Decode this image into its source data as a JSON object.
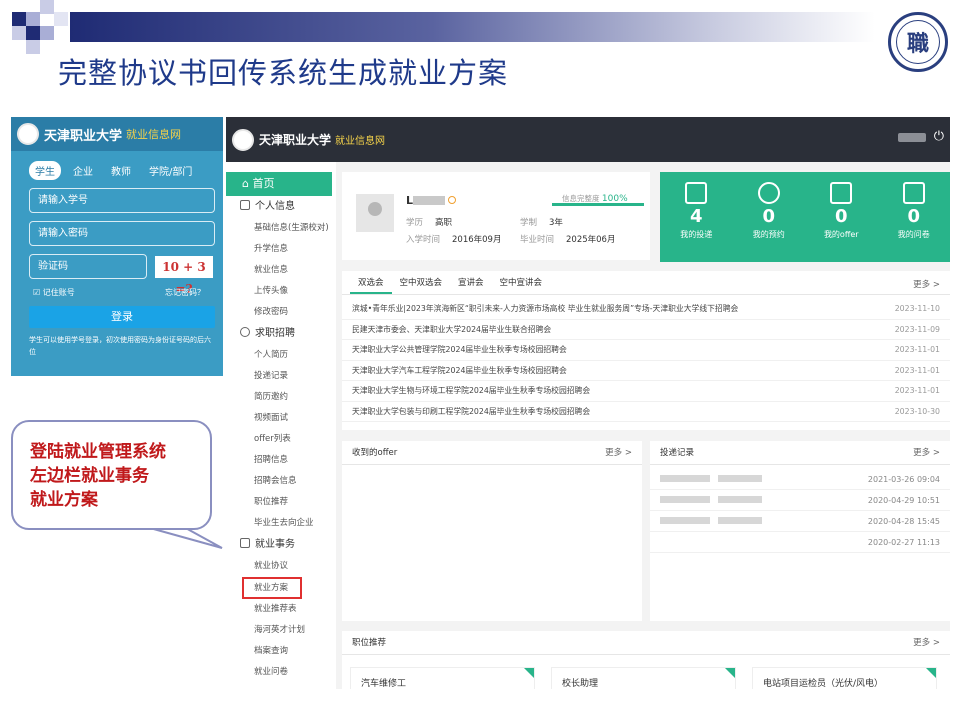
{
  "slide": {
    "title": "完整协议书回传系统生成就业方案",
    "callout_lines": [
      "登陆就业管理系统",
      "左边栏就业事务",
      "就业方案"
    ],
    "brand_color": "#1f2b74"
  },
  "login": {
    "school": "天津职业大学",
    "system": "就业信息网",
    "roles": [
      "学生",
      "企业",
      "教师",
      "学院/部门"
    ],
    "active_role": "学生",
    "id_placeholder": "请输入学号",
    "password_placeholder": "请输入密码",
    "captcha_placeholder": "验证码",
    "captcha_text": "10 + 3 =?",
    "remember_label": "记住账号",
    "forgot_label": "忘记密码？",
    "login_button": "登录",
    "note": "学生可以使用学号登录，初次使用密码为身份证号码的后六位"
  },
  "app": {
    "school": "天津职业大学",
    "system": "就业信息网",
    "accent": "#28b48a",
    "sidebar": {
      "home": "首页",
      "groups": [
        {
          "label": "个人信息",
          "items": [
            "基础信息(生源校对)",
            "升学信息",
            "就业信息",
            "上传头像",
            "修改密码"
          ]
        },
        {
          "label": "求职招聘",
          "items": [
            "个人简历",
            "投递记录",
            "简历邀约",
            "视频面试",
            "offer列表",
            "招聘信息",
            "招聘会信息",
            "职位推荐",
            "毕业生去向企业"
          ]
        },
        {
          "label": "就业事务",
          "items": [
            "就业协议",
            "就业方案",
            "就业推荐表",
            "海河英才计划",
            "档案查询",
            "就业问卷"
          ]
        }
      ],
      "selected_item": "就业方案"
    },
    "profile": {
      "name_initial": "L",
      "education_label": "学历",
      "education": "高职",
      "length_label": "学制",
      "length": "3年",
      "entry_label": "入学时间",
      "entry": "2016年09月",
      "grad_label": "毕业时间",
      "grad": "2025年06月",
      "completeness_label": "信息完整度",
      "completeness": "100%",
      "completeness_value": 1.0
    },
    "stats": [
      {
        "label": "我的投递",
        "value": "4"
      },
      {
        "label": "我的预约",
        "value": "0"
      },
      {
        "label": "我的offer",
        "value": "0"
      },
      {
        "label": "我的问卷",
        "value": "0"
      }
    ],
    "news": {
      "tabs": [
        "双选会",
        "空中双选会",
        "宣讲会",
        "空中宣讲会"
      ],
      "active_tab": "双选会",
      "more": "更多 >",
      "rows": [
        {
          "title": "滨城•青年乐业|2023年滨海新区“职引未来-人力资源市场高校 毕业生就业服务周”专场-天津职业大学线下招聘会",
          "date": "2023-11-10"
        },
        {
          "title": "民建天津市委会、天津职业大学2024届毕业生联合招聘会",
          "date": "2023-11-09"
        },
        {
          "title": "天津职业大学公共管理学院2024届毕业生秋季专场校园招聘会",
          "date": "2023-11-01"
        },
        {
          "title": "天津职业大学汽车工程学院2024届毕业生秋季专场校园招聘会",
          "date": "2023-11-01"
        },
        {
          "title": "天津职业大学生物与环境工程学院2024届毕业生秋季专场校园招聘会",
          "date": "2023-11-01"
        },
        {
          "title": "天津职业大学包装与印刷工程学院2024届毕业生秋季专场校园招聘会",
          "date": "2023-10-30"
        }
      ]
    },
    "offers": {
      "title": "收到的offer",
      "more": "更多 >"
    },
    "deliveries": {
      "title": "投递记录",
      "more": "更多 >",
      "dates": [
        "2021-03-26 09:04",
        "2020-04-29 10:51",
        "2020-04-28 15:45",
        "2020-02-27 11:13"
      ]
    },
    "recommend": {
      "title": "职位推荐",
      "more": "更多 >",
      "cards": [
        "汽车维修工",
        "校长助理",
        "电站项目运检员（光伏/风电）"
      ]
    }
  }
}
